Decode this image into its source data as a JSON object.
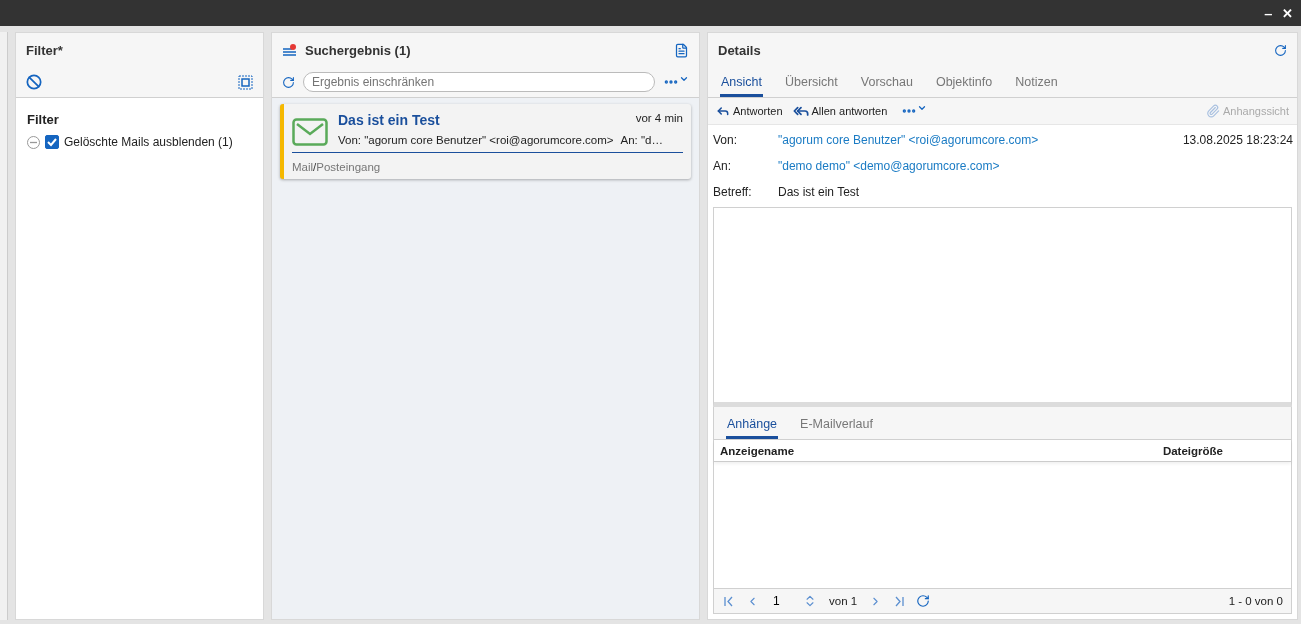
{
  "window": {
    "controls": [
      "‒",
      "✕"
    ]
  },
  "filter_panel": {
    "title": "Filter*",
    "section_title": "Filter",
    "items": [
      {
        "label": "Gelöschte Mails ausblenden (1)",
        "checked": true,
        "expanded": true
      }
    ]
  },
  "search_panel": {
    "title": "Suchergebnis (1)",
    "search": {
      "placeholder": "Ergebnis einschränken"
    },
    "results": [
      {
        "title": "Das ist ein Test",
        "time": "vor 4 min",
        "from": "Von: \"agorum core Benutzer\" <roi@agorumcore.com>",
        "to": "An: \"d…",
        "path": [
          "Mail",
          "Posteingang"
        ],
        "path_separator": "/",
        "selected": true
      }
    ]
  },
  "details": {
    "title": "Details",
    "tabs": [
      {
        "label": "Ansicht",
        "selected": true
      },
      {
        "label": "Übersicht",
        "selected": false
      },
      {
        "label": "Vorschau",
        "selected": false
      },
      {
        "label": "Objektinfo",
        "selected": false
      },
      {
        "label": "Notizen",
        "selected": false
      }
    ],
    "toolbar": [
      {
        "label": "Antworten",
        "kind": "reply"
      },
      {
        "label": "Allen antworten",
        "kind": "reply-all"
      }
    ],
    "attachment_view": {
      "label": "Anhangssicht",
      "disabled": true
    },
    "fields": [
      {
        "label": "Von:",
        "value": "\"agorum core Benutzer\" <roi@agorumcore.com>",
        "kind": "link",
        "date": "13.08.2025 18:23:24"
      },
      {
        "label": "An:",
        "value": "\"demo demo\" <demo@agorumcore.com>",
        "kind": "link"
      },
      {
        "label": "Betreff:",
        "value": "Das ist ein Test",
        "kind": "text"
      }
    ],
    "lower_tabs": [
      {
        "label": "Anhänge",
        "selected": true
      },
      {
        "label": "E-Mailverlauf",
        "selected": false
      }
    ],
    "table": {
      "columns": [
        "Anzeigename",
        "Dateigröße"
      ]
    },
    "pager": {
      "page": "1",
      "of": "von 1",
      "summary": "1 - 0 von 0"
    }
  }
}
